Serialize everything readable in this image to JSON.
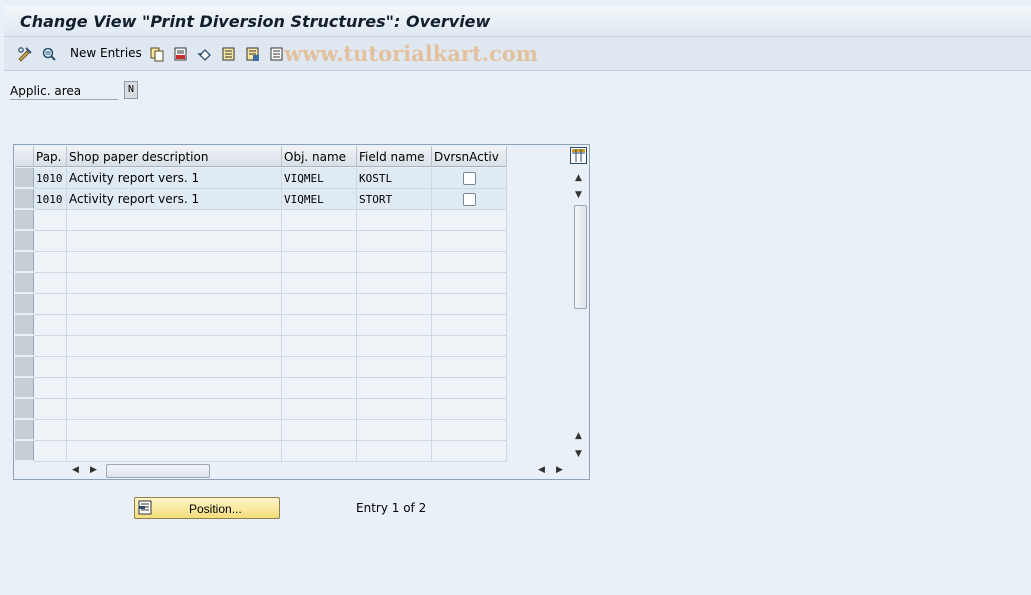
{
  "window": {
    "title": "Change View \"Print Diversion Structures\": Overview",
    "watermark": "www.tutorialkart.com"
  },
  "toolbar": {
    "new_entries_label": "New Entries",
    "icons": [
      "display-change-icon",
      "other-view-icon",
      "copy-icon",
      "delete-icon",
      "undo-icon",
      "select-all-icon",
      "select-block-icon",
      "deselect-all-icon"
    ]
  },
  "field": {
    "label": "Applic. area",
    "value": "N"
  },
  "table": {
    "columns": [
      "Pap.",
      "Shop paper description",
      "Obj. name",
      "Field name",
      "DvrsnActiv"
    ],
    "rows": [
      {
        "pap": "1010",
        "desc": "Activity report vers. 1",
        "obj": "VIQMEL",
        "field": "KOSTL",
        "active": false
      },
      {
        "pap": "1010",
        "desc": "Activity report vers. 1",
        "obj": "VIQMEL",
        "field": "STORT",
        "active": false
      }
    ],
    "empty_rows": 12
  },
  "position_button": {
    "label": "Position..."
  },
  "entry_info": "Entry 1 of 2",
  "colors": {
    "background": "#e9f0f7",
    "row_fill": "#e0eaf3",
    "button_yellow": "#f5dd7a"
  }
}
